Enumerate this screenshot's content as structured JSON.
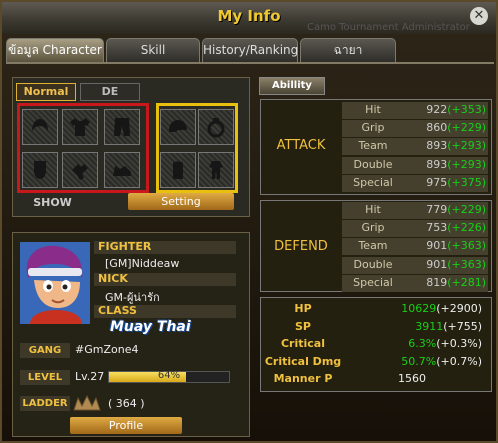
{
  "window": {
    "title": "My Info"
  },
  "background_text": "Camo Tournament Administrator",
  "tabs": [
    {
      "label": "ข้อมูล Character",
      "active": true
    },
    {
      "label": "Skill",
      "active": false
    },
    {
      "label": "History/Ranking",
      "active": false
    },
    {
      "label": "ฉายา",
      "active": false
    }
  ],
  "equip": {
    "subtabs": [
      "Normal",
      "DE"
    ],
    "slots_left": [
      "hair-icon",
      "shirt-icon",
      "pants-icon",
      "face-icon",
      "gloves-icon",
      "shoes-icon"
    ],
    "slots_right": [
      "cap-icon",
      "ring-icon",
      "backpack-icon",
      "outfit-icon"
    ],
    "show_label": "SHOW",
    "setting_label": "Setting"
  },
  "profile": {
    "fighter_label": "FIGHTER",
    "fighter_name": "[GM]Niddeaw",
    "nick_label": "NICK",
    "nick_value": "GM-ผู้น่ารัก",
    "class_label": "CLASS",
    "class_value": "Muay Thai",
    "gang_label": "GANG",
    "gang_value": "#GmZone4",
    "level_label": "LEVEL",
    "level_value": "Lv.27",
    "level_progress_label": "64%",
    "level_progress": 0.64,
    "ladder_label": "LADDER",
    "ladder_value": "( 364 )",
    "profile_button": "Profile"
  },
  "ability": {
    "tab": "Abillity",
    "attack": {
      "title": "ATTACK",
      "rows": [
        {
          "name": "Hit",
          "base": "922",
          "bonus": "(+353)"
        },
        {
          "name": "Grip",
          "base": "860",
          "bonus": "(+229)"
        },
        {
          "name": "Team",
          "base": "893",
          "bonus": "(+293)"
        },
        {
          "name": "Double",
          "base": "893",
          "bonus": "(+293)"
        },
        {
          "name": "Special",
          "base": "975",
          "bonus": "(+375)"
        }
      ]
    },
    "defend": {
      "title": "DEFEND",
      "rows": [
        {
          "name": "Hit",
          "base": "779",
          "bonus": "(+229)"
        },
        {
          "name": "Grip",
          "base": "753",
          "bonus": "(+226)"
        },
        {
          "name": "Team",
          "base": "901",
          "bonus": "(+363)"
        },
        {
          "name": "Double",
          "base": "901",
          "bonus": "(+363)"
        },
        {
          "name": "Special",
          "base": "819",
          "bonus": "(+281)"
        }
      ]
    },
    "totals": [
      {
        "name": "HP",
        "base": "10629",
        "bonus": "(+2900)"
      },
      {
        "name": "SP",
        "base": "3911",
        "bonus": "(+755)"
      },
      {
        "name": "Critical",
        "base": "6.3%",
        "bonus": "(+0.3%)"
      },
      {
        "name": "Critical Dmg",
        "base": "50.7%",
        "bonus": "(+0.7%)"
      },
      {
        "name": "Manner P",
        "base": "1560",
        "bonus": ""
      }
    ]
  }
}
